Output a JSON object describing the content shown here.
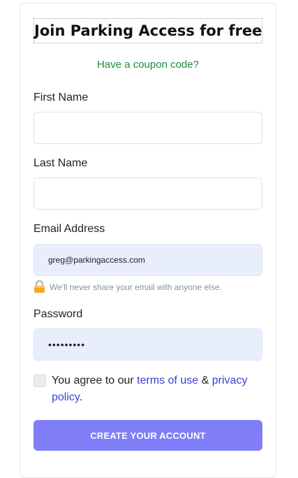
{
  "form": {
    "title": "Join Parking Access for free",
    "coupon_link": "Have a coupon code?",
    "first_name": {
      "label": "First Name",
      "value": ""
    },
    "last_name": {
      "label": "Last Name",
      "value": ""
    },
    "email": {
      "label": "Email Address",
      "value": "greg@parkingaccess.com",
      "hint": "We'll never share your email with anyone else.",
      "hint_icon": "lock-icon"
    },
    "password": {
      "label": "Password",
      "value": "•••••••••"
    },
    "agree": {
      "checked": false,
      "text_prefix": "You agree to our ",
      "terms_link": "terms of use",
      "and_text": " & ",
      "privacy_link": "privacy policy",
      "suffix": "."
    },
    "submit_label": "CREATE YOUR ACCOUNT"
  },
  "colors": {
    "accent": "#7f7ef8",
    "link": "#3b3fd6",
    "coupon": "#1f8a3b",
    "autofill": "#e8eefb"
  }
}
